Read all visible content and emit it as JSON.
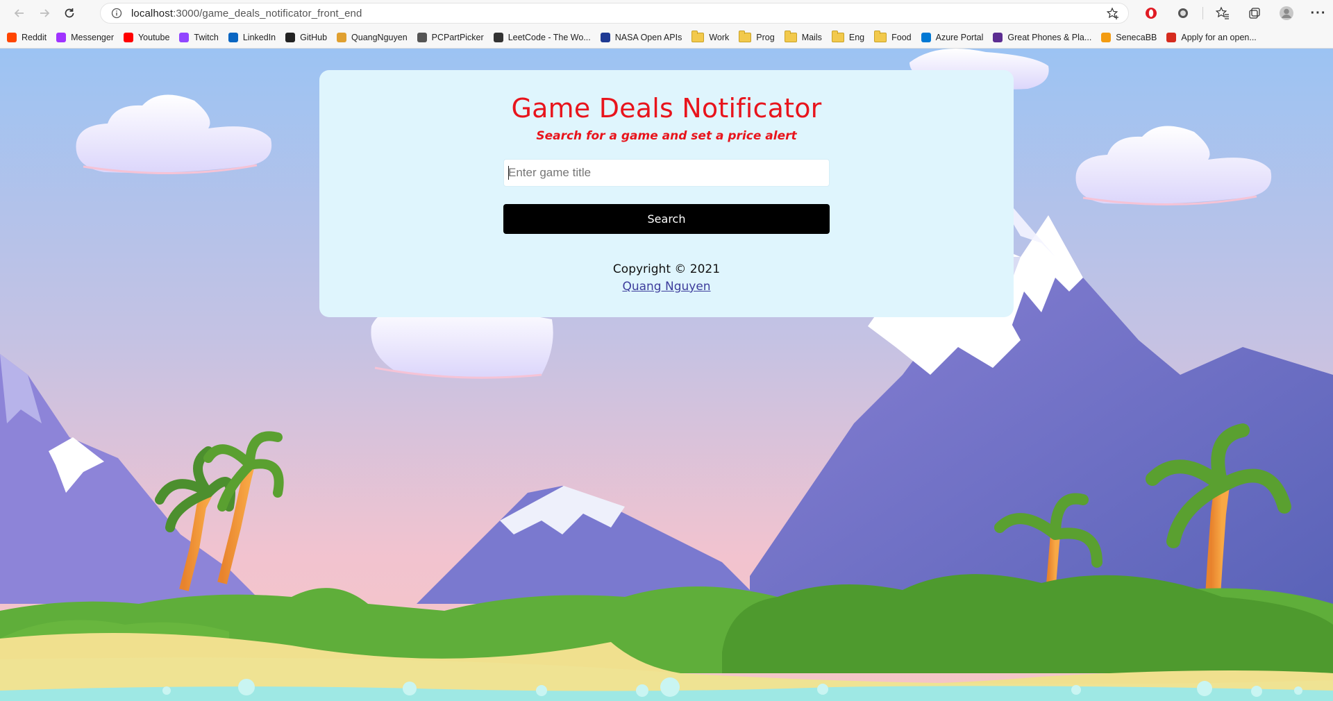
{
  "browser": {
    "url_host": "localhost",
    "url_path": ":3000/game_deals_notificator_front_end",
    "bookmarks": [
      {
        "label": "Reddit",
        "icon": "reddit-icon",
        "color": "#ff4500"
      },
      {
        "label": "Messenger",
        "icon": "messenger-icon",
        "color": "#a033ff"
      },
      {
        "label": "Youtube",
        "icon": "youtube-icon",
        "color": "#ff0000"
      },
      {
        "label": "Twitch",
        "icon": "twitch-icon",
        "color": "#9146ff"
      },
      {
        "label": "LinkedIn",
        "icon": "linkedin-icon",
        "color": "#0a66c2"
      },
      {
        "label": "GitHub",
        "icon": "github-icon",
        "color": "#222222"
      },
      {
        "label": "QuangNguyen",
        "icon": "bulb-icon",
        "color": "#e0a030"
      },
      {
        "label": "PCPartPicker",
        "icon": "pcpartpicker-icon",
        "color": "#555555"
      },
      {
        "label": "LeetCode - The Wo...",
        "icon": "leetcode-icon",
        "color": "#333333"
      },
      {
        "label": "NASA Open APIs",
        "icon": "nasa-icon",
        "color": "#1f3a93"
      },
      {
        "label": "Work",
        "icon": "folder-icon",
        "color": "#f2c94c"
      },
      {
        "label": "Prog",
        "icon": "folder-icon",
        "color": "#f2c94c"
      },
      {
        "label": "Mails",
        "icon": "folder-icon",
        "color": "#f2c94c"
      },
      {
        "label": "Eng",
        "icon": "folder-icon",
        "color": "#f2c94c"
      },
      {
        "label": "Food",
        "icon": "folder-icon",
        "color": "#f2c94c"
      },
      {
        "label": "Azure Portal",
        "icon": "azure-icon",
        "color": "#0078d4"
      },
      {
        "label": "Great Phones & Pla...",
        "icon": "phones-icon",
        "color": "#5c2d91"
      },
      {
        "label": "SenecaBB",
        "icon": "seneca-icon",
        "color": "#f39c12"
      },
      {
        "label": "Apply for an open...",
        "icon": "maple-leaf-icon",
        "color": "#d52b1e"
      }
    ]
  },
  "app": {
    "title": "Game Deals Notificator",
    "subtitle": "Search for a game and set a price alert",
    "search_placeholder": "Enter game title",
    "search_value": "",
    "search_button": "Search",
    "copyright": "Copyright © 2021",
    "author": "Quang Nguyen"
  },
  "colors": {
    "title": "#e8141c",
    "card_bg": "#dff5fd",
    "button_bg": "#000000"
  }
}
